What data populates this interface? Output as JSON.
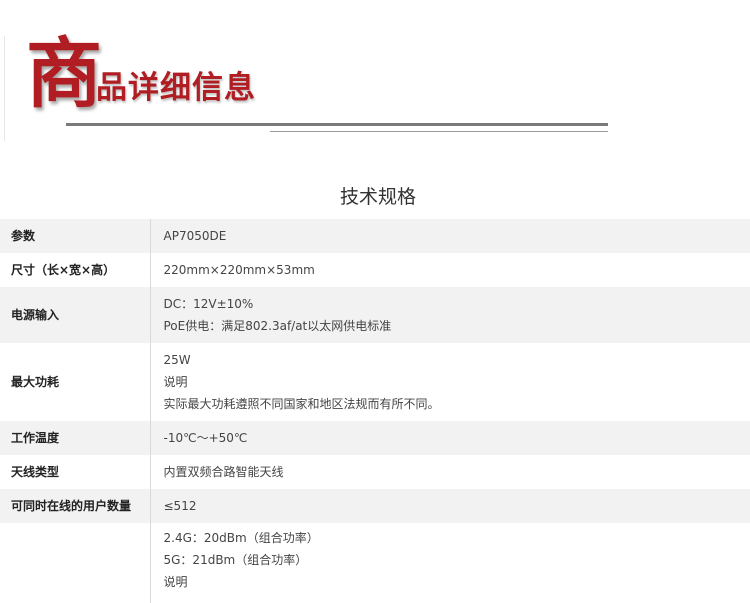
{
  "header": {
    "big_char": "商",
    "rest": "品详细信息"
  },
  "section_title": "技术规格",
  "rows": [
    {
      "key": "参数",
      "lines": [
        "AP7050DE"
      ]
    },
    {
      "key": "尺寸（长×宽×高）",
      "lines": [
        "220mm×220mm×53mm"
      ]
    },
    {
      "key": "电源输入",
      "lines": [
        "DC：12V±10%",
        "PoE供电：满足802.3af/at以太网供电标准"
      ]
    },
    {
      "key": "最大功耗",
      "lines": [
        "25W",
        "说明",
        "实际最大功耗遵照不同国家和地区法规而有所不同。"
      ]
    },
    {
      "key": "工作温度",
      "lines": [
        "-10℃～+50℃"
      ]
    },
    {
      "key": "天线类型",
      "lines": [
        "内置双频合路智能天线"
      ]
    },
    {
      "key": "可同时在线的用户数量",
      "lines": [
        "≤512"
      ]
    },
    {
      "key": "",
      "lines": [
        "2.4G：20dBm（组合功率）",
        "5G：21dBm（组合功率）",
        "说明"
      ]
    }
  ]
}
